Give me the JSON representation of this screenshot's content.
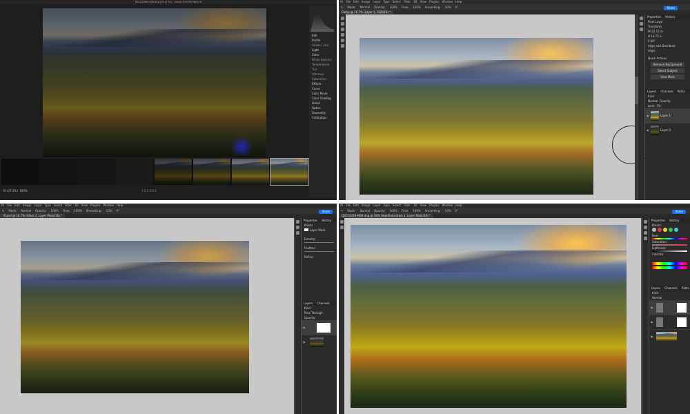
{
  "q1": {
    "title": "DSC03356-HDR.dng (19 of 31)  ·  Canon EOS 5D Mark IV",
    "zoom_label": "Fit (27.3%)",
    "zoom_value": "100%",
    "panel_sections": [
      "Edit",
      "Profile",
      "Light",
      "Color",
      "White balance",
      "Temperature",
      "Tint",
      "Vibrance",
      "Saturation",
      "Effects",
      "Curve",
      "Color Mixer",
      "Color Grading",
      "Detail",
      "Optics",
      "Geometry",
      "Calibration"
    ],
    "profile_value": "Adobe Color",
    "pager": "1 2 3 4 5 6"
  },
  "q2": {
    "menu": [
      "Ps",
      "File",
      "Edit",
      "Image",
      "Layer",
      "Type",
      "Select",
      "Filter",
      "3D",
      "View",
      "Plugins",
      "Window",
      "Help"
    ],
    "options": [
      "Mode:",
      "Normal",
      "Opacity:",
      "100%",
      "Flow:",
      "100%",
      "Smoothing:",
      "10%",
      "0°"
    ],
    "doc_tab": "Camp @ 16.7% (Layer 1, RGB/16) *",
    "share": "Share",
    "panel_tabs": [
      "Properties",
      "History"
    ],
    "pixel_layer": "Pixel Layer",
    "transform": "Transform",
    "w": "W",
    "h": "H",
    "w_val": "22.15 in",
    "h_val": "14.75 in",
    "angle": "0.00°",
    "align": "Align and Distribute",
    "align_sub": "Align:",
    "quick_actions": "Quick Actions",
    "remove_bg": "Remove Background",
    "select_subject": "Select Subject",
    "view_more": "View More",
    "layer_tabs": [
      "Layers",
      "Channels",
      "Paths"
    ],
    "kind": "Kind",
    "blend": "Normal",
    "opacity": "Opacity:",
    "lock": "Lock:",
    "fill": "Fill:",
    "layers": [
      "Layer 1",
      "Layer 0"
    ]
  },
  "q3": {
    "menu": [
      "Ps",
      "File",
      "Edit",
      "Image",
      "Layer",
      "Type",
      "Select",
      "Filter",
      "3D",
      "View",
      "Plugins",
      "Window",
      "Help"
    ],
    "options": [
      "Mode:",
      "Normal",
      "Opacity:",
      "100%",
      "Flow:",
      "100%",
      "Smoothing:",
      "10%",
      "0°"
    ],
    "doc_tab": "tR.psd @ 16.7% (Gloss 1, Layer Mask/16) *",
    "share": "Share",
    "panel_tabs": [
      "Properties",
      "History"
    ],
    "masks": "Masks",
    "layer_mask": "Layer Mask",
    "density": "Density:",
    "feather": "Feather:",
    "refine": "Refine:",
    "layer_tabs": [
      "Layers",
      "Channels"
    ],
    "kind": "Kind",
    "blend": "Pass Through",
    "opacity": "Opacity:"
  },
  "q4": {
    "menu": [
      "Ps",
      "File",
      "Edit",
      "Image",
      "Layer",
      "Type",
      "Select",
      "Filter",
      "3D",
      "View",
      "Plugins",
      "Window",
      "Help"
    ],
    "options": [
      "Mode:",
      "Normal",
      "Opacity:",
      "100%",
      "Flow:",
      "100%",
      "Smoothing:",
      "10%",
      "0°"
    ],
    "doc_tab": "DSC03356-HDR.dng @ 18% (Hue/Saturation 1, Layer Mask/16) *",
    "share": "Share",
    "panel_tabs": [
      "Properties",
      "History"
    ],
    "preset": "Preset:",
    "hue": "Hue:",
    "saturation": "Saturation:",
    "lightness": "Lightness:",
    "colorize": "Colorize",
    "layer_tabs": [
      "Layers",
      "Channels",
      "Paths"
    ],
    "kind": "Kind",
    "blend": "Normal"
  }
}
